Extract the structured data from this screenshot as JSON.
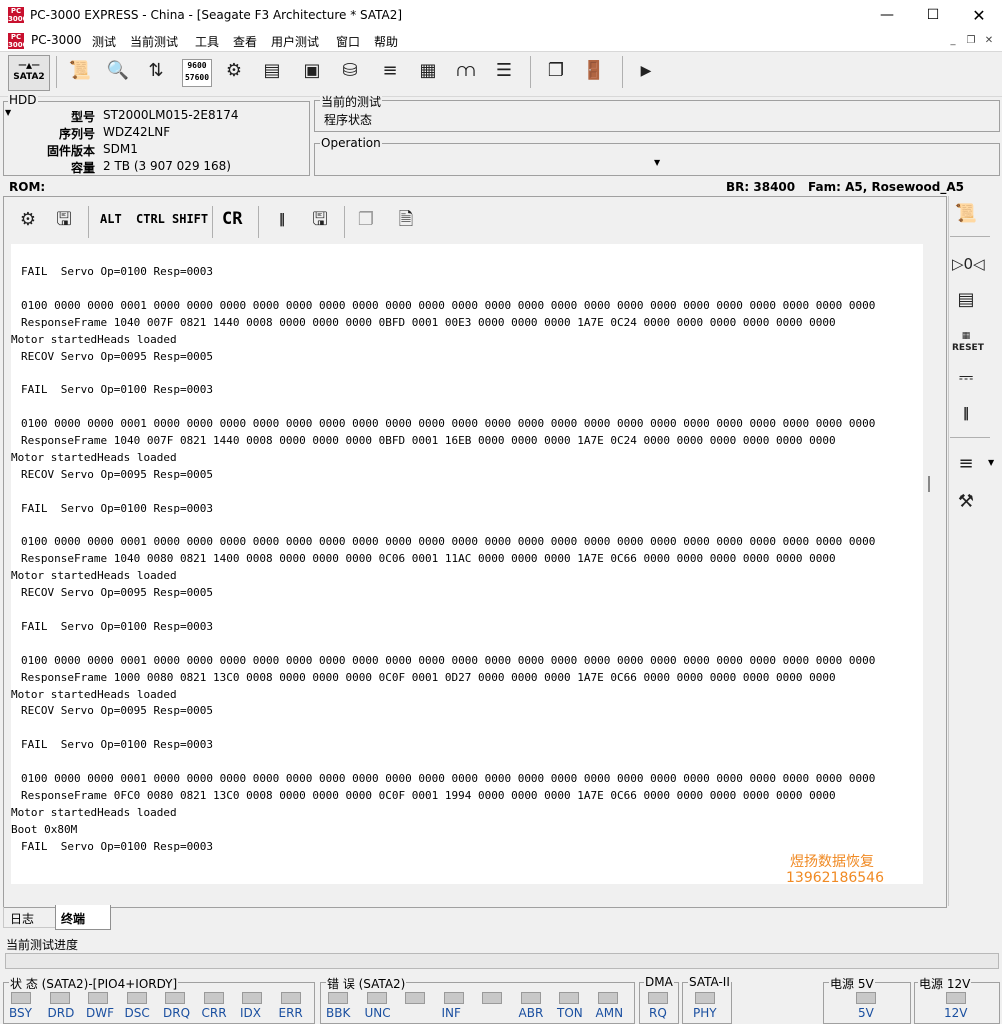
{
  "window": {
    "title": "PC-3000 EXPRESS - China - [Seagate F3 Architecture * SATA2]",
    "app_icon_text": "PC 3000"
  },
  "menu": [
    "PC-3000",
    "测试",
    "当前测试",
    "工具",
    "查看",
    "用户测试",
    "窗口",
    "帮助"
  ],
  "toolbar": {
    "sata_label": "SATA2",
    "speed_label_top": "9600",
    "speed_label_bottom": "57600"
  },
  "hdd": {
    "group_title": "HDD",
    "fields": [
      {
        "label": "型号",
        "value": "ST2000LM015-2E8174"
      },
      {
        "label": "序列号",
        "value": "WDZ42LNF"
      },
      {
        "label": "固件版本",
        "value": "SDM1"
      },
      {
        "label": "容量",
        "value": "2 TB (3 907 029 168)"
      }
    ]
  },
  "current_test": {
    "group_title": "当前的测试",
    "value": "程序状态"
  },
  "operation": {
    "group_title": "Operation"
  },
  "rom_bar": {
    "rom": "ROM:",
    "br": "BR: 38400",
    "fam": "Fam: A5, Rosewood_A5"
  },
  "terminal_toolbar": {
    "alt": "ALT",
    "ctrl": "CTRL",
    "shift": "SHIFT",
    "cr": "CR"
  },
  "terminal": {
    "lines": [
      {
        "t": "FAIL  Servo Op=0100 Resp=0003",
        "i": true
      },
      {
        "t": "",
        "i": false
      },
      {
        "t": "0100 0000 0000 0001 0000 0000 0000 0000 0000 0000 0000 0000 0000 0000 0000 0000 0000 0000 0000 0000 0000 0000 0000 0000 0000 0000",
        "i": true
      },
      {
        "t": "ResponseFrame 1040 007F 0821 1440 0008 0000 0000 0000 0BFD 0001 00E3 0000 0000 0000 1A7E 0C24 0000 0000 0000 0000 0000 0000",
        "i": true
      },
      {
        "t": "Motor startedHeads loaded",
        "i": false
      },
      {
        "t": "RECOV Servo Op=0095 Resp=0005",
        "i": true
      },
      {
        "t": "",
        "i": false
      },
      {
        "t": "FAIL  Servo Op=0100 Resp=0003",
        "i": true
      },
      {
        "t": "",
        "i": false
      },
      {
        "t": "0100 0000 0000 0001 0000 0000 0000 0000 0000 0000 0000 0000 0000 0000 0000 0000 0000 0000 0000 0000 0000 0000 0000 0000 0000 0000",
        "i": true
      },
      {
        "t": "ResponseFrame 1040 007F 0821 1440 0008 0000 0000 0000 0BFD 0001 16EB 0000 0000 0000 1A7E 0C24 0000 0000 0000 0000 0000 0000",
        "i": true
      },
      {
        "t": "Motor startedHeads loaded",
        "i": false
      },
      {
        "t": "RECOV Servo Op=0095 Resp=0005",
        "i": true
      },
      {
        "t": "",
        "i": false
      },
      {
        "t": "FAIL  Servo Op=0100 Resp=0003",
        "i": true
      },
      {
        "t": "",
        "i": false
      },
      {
        "t": "0100 0000 0000 0001 0000 0000 0000 0000 0000 0000 0000 0000 0000 0000 0000 0000 0000 0000 0000 0000 0000 0000 0000 0000 0000 0000",
        "i": true
      },
      {
        "t": "ResponseFrame 1040 0080 0821 1400 0008 0000 0000 0000 0C06 0001 11AC 0000 0000 0000 1A7E 0C66 0000 0000 0000 0000 0000 0000",
        "i": true
      },
      {
        "t": "Motor startedHeads loaded",
        "i": false
      },
      {
        "t": "RECOV Servo Op=0095 Resp=0005",
        "i": true
      },
      {
        "t": "",
        "i": false
      },
      {
        "t": "FAIL  Servo Op=0100 Resp=0003",
        "i": true
      },
      {
        "t": "",
        "i": false
      },
      {
        "t": "0100 0000 0000 0001 0000 0000 0000 0000 0000 0000 0000 0000 0000 0000 0000 0000 0000 0000 0000 0000 0000 0000 0000 0000 0000 0000",
        "i": true
      },
      {
        "t": "ResponseFrame 1000 0080 0821 13C0 0008 0000 0000 0000 0C0F 0001 0D27 0000 0000 0000 1A7E 0C66 0000 0000 0000 0000 0000 0000",
        "i": true
      },
      {
        "t": "Motor startedHeads loaded",
        "i": false
      },
      {
        "t": "RECOV Servo Op=0095 Resp=0005",
        "i": true
      },
      {
        "t": "",
        "i": false
      },
      {
        "t": "FAIL  Servo Op=0100 Resp=0003",
        "i": true
      },
      {
        "t": "",
        "i": false
      },
      {
        "t": "0100 0000 0000 0001 0000 0000 0000 0000 0000 0000 0000 0000 0000 0000 0000 0000 0000 0000 0000 0000 0000 0000 0000 0000 0000 0000",
        "i": true
      },
      {
        "t": "ResponseFrame 0FC0 0080 0821 13C0 0008 0000 0000 0000 0C0F 0001 1994 0000 0000 0000 1A7E 0C66 0000 0000 0000 0000 0000 0000",
        "i": true
      },
      {
        "t": "Motor startedHeads loaded",
        "i": false
      },
      {
        "t": "Boot 0x80M",
        "i": false
      },
      {
        "t": "FAIL  Servo Op=0100 Resp=0003",
        "i": true
      }
    ],
    "cursor": "—",
    "watermark_name": "煜扬数据恢复",
    "watermark_phone": "13962186546"
  },
  "tabs": [
    "日志",
    "终端"
  ],
  "progress": {
    "label": "当前测试进度",
    "value": 0
  },
  "status": {
    "group1_title": "状 态 (SATA2)-[PIO4+IORDY]",
    "group1": [
      "BSY",
      "DRD",
      "DWF",
      "DSC",
      "DRQ",
      "CRR",
      "IDX",
      "ERR"
    ],
    "group2_title": "错 误 (SATA2)",
    "group2": [
      "BBK",
      "UNC",
      "",
      "INF",
      "",
      "ABR",
      "TON",
      "AMN"
    ],
    "dma_title": "DMA",
    "dma": "RQ",
    "sata_title": "SATA-II",
    "sata": "PHY",
    "power5_title": "电源 5V",
    "power5": "5V",
    "power12_title": "电源 12V",
    "power12": "12V"
  },
  "colors": {
    "accent": "#1a4fa0",
    "watermark": "#f08a24",
    "app_icon": "#c8102e"
  }
}
